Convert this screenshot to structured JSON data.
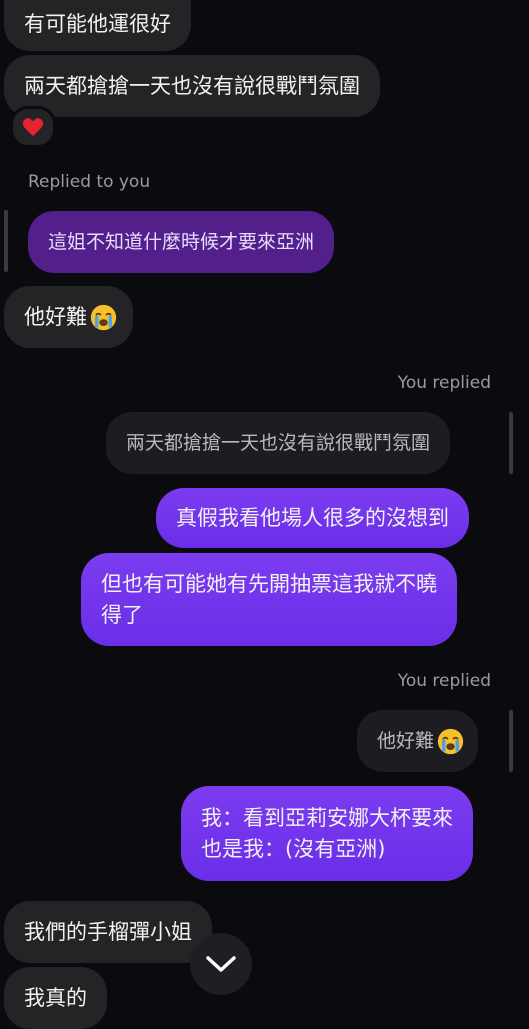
{
  "messages": {
    "m1": "有可能他運很好",
    "m2": "兩天都搶搶一天也沒有說很戰鬥氛圍",
    "m2_reaction": "❤️",
    "reply_label_1": "Replied to you",
    "m3_quote": "這姐不知道什麼時候才要來亞洲",
    "m3_text": "他好難",
    "reply_label_2": "You replied",
    "m4_quote": "兩天都搶搶一天也沒有說很戰鬥氛圍",
    "m4_text": "真假我看他場人很多的沒想到",
    "m5_line1": "但也有可能她有先開抽票這我就不曉",
    "m5_line2": "得了",
    "reply_label_3": "You replied",
    "m6_quote": "他好難",
    "m6_line1": "我：看到亞莉安娜大杯要來",
    "m6_line2": "也是我：(沒有亞洲)",
    "m7": "我們的手榴彈小姐",
    "m8": "我真的"
  },
  "colors": {
    "background": "#0b0b0f",
    "incoming_bubble": "#242427",
    "outgoing_bubble": "#7c3cf0",
    "quoted_incoming": "#521f8b"
  },
  "icons": {
    "scroll": "chevron-down-icon",
    "emoji": "loudly-crying-face-icon"
  }
}
